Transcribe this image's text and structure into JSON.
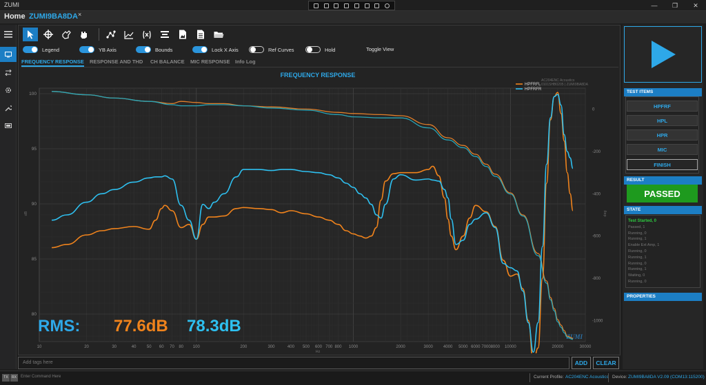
{
  "app": {
    "title": "ZUMI"
  },
  "tabs": {
    "home": "Home",
    "device": "ZUMI9BA8DA",
    "close_glyph": "×"
  },
  "toolbar": {
    "icons": [
      "select-arrow-icon",
      "crosshair-icon",
      "pan-hand-icon",
      "grab-hand-icon",
      "scatter-icon",
      "line-chart-icon",
      "function-icon",
      "align-icon",
      "export-image-icon",
      "document-icon",
      "open-folder-icon"
    ]
  },
  "toggles": {
    "legend": "Legend",
    "yb_axis": "YB Axis",
    "bounds": "Bounds",
    "lock_x_axis": "Lock X Axis",
    "ref_curves": "Ref Curves",
    "hold": "Hold",
    "toggle_view": "Toggle View"
  },
  "subtabs": [
    "FREQUENCY RESPONSE",
    "RESPONSE AND THD",
    "CH BALANCE",
    "MIC RESPONSE",
    "Info Log"
  ],
  "chart_data": {
    "type": "line",
    "title": "FREQUENCY RESPONSE",
    "watermark_lines": [
      "AC204ENC Acoustics",
      "0101SHB0205 | ZUMI9BA8DA"
    ],
    "brand_mark": "ZUMI",
    "xlabel": "Hz",
    "ylabel": "dB",
    "y2label": "deg",
    "x_scale": "log",
    "xlim": [
      10,
      30000
    ],
    "ylim": [
      77.5,
      100.5
    ],
    "y2lim": [
      -1100,
      100
    ],
    "x_ticks": [
      "10",
      "20",
      "30",
      "40",
      "50",
      "60",
      "70",
      "80",
      "100",
      "200",
      "300",
      "400",
      "500",
      "600",
      "700",
      "800",
      "1000",
      "2000",
      "3000",
      "4000",
      "5000",
      "6000",
      "7000",
      "8000",
      "10000",
      "20000",
      "30000"
    ],
    "y_ticks": [
      "100",
      "95",
      "90",
      "85",
      "80"
    ],
    "y2_ticks": [
      "0",
      "-200",
      "-400",
      "-600",
      "-800",
      "-1000"
    ],
    "grid": true,
    "legend_position": "top-right",
    "series": [
      {
        "name": "HPFRFL",
        "color": "#f0831c",
        "axis": "y2",
        "x": [
          12,
          15,
          20,
          25,
          30,
          40,
          50,
          55,
          60,
          63,
          70,
          80,
          90,
          100,
          110,
          120,
          130,
          150,
          180,
          200,
          250,
          300,
          350,
          400,
          500,
          600,
          700,
          800,
          900,
          1000,
          1100,
          1200,
          1300,
          1400,
          1500,
          1600,
          1800,
          2000,
          2500,
          3000,
          3200,
          3500,
          3800,
          4000,
          4200,
          4500,
          5000,
          5500,
          6000,
          7000,
          8000,
          9000,
          10000,
          11000,
          12000,
          13000,
          14000,
          15000,
          16000,
          17000,
          18000,
          19000,
          20000,
          21000,
          22000,
          23000,
          24000,
          25000
        ],
        "values": [
          -655,
          -640,
          -595,
          -575,
          -565,
          -555,
          -568,
          -525,
          -470,
          -455,
          -480,
          -560,
          -545,
          -615,
          -545,
          -510,
          -510,
          -505,
          -470,
          -465,
          -470,
          -475,
          -490,
          -480,
          -495,
          -510,
          -525,
          -545,
          -575,
          -590,
          -600,
          -610,
          -600,
          -560,
          -430,
          -340,
          -305,
          -300,
          -300,
          -285,
          -270,
          -315,
          -420,
          -520,
          -600,
          -665,
          -600,
          -515,
          -455,
          -485,
          -555,
          -715,
          -790,
          -780,
          -850,
          -1000,
          -1200,
          -1130,
          -800,
          -350,
          -50,
          60,
          80,
          -20,
          -150,
          -300,
          -400,
          -480
        ]
      },
      {
        "name": "HPFRFR",
        "color": "#2ec0f0",
        "axis": "y2",
        "x": [
          12,
          15,
          20,
          25,
          30,
          40,
          50,
          55,
          60,
          63,
          70,
          80,
          90,
          100,
          110,
          120,
          130,
          150,
          180,
          200,
          250,
          300,
          350,
          400,
          500,
          600,
          700,
          800,
          900,
          1000,
          1100,
          1200,
          1300,
          1400,
          1500,
          1600,
          1800,
          2000,
          2500,
          3000,
          3200,
          3500,
          3800,
          4000,
          4200,
          4500,
          5000,
          5500,
          6000,
          7000,
          8000,
          9000,
          10000,
          11000,
          12000,
          13000,
          14000,
          15000,
          16000,
          17000,
          18000,
          19000,
          20000,
          21000,
          22000,
          23000,
          24000,
          25000
        ],
        "values": [
          -525,
          -500,
          -440,
          -400,
          -380,
          -345,
          -325,
          -320,
          -320,
          -315,
          -330,
          -455,
          -525,
          -615,
          -450,
          -470,
          -440,
          -400,
          -320,
          -285,
          -285,
          -290,
          -285,
          -285,
          -295,
          -300,
          -310,
          -325,
          -350,
          -370,
          -400,
          -420,
          -450,
          -500,
          -515,
          -450,
          -330,
          -310,
          -335,
          -330,
          -335,
          -340,
          -380,
          -420,
          -520,
          -640,
          -620,
          -545,
          -520,
          -490,
          -560,
          -730,
          -750,
          -765,
          -860,
          -1010,
          -1150,
          -1010,
          -650,
          -260,
          -40,
          60,
          70,
          20,
          -120,
          -200,
          -230,
          -280
        ]
      },
      {
        "name": "",
        "color": "#e07e2a",
        "axis": "y",
        "x": [
          12,
          20,
          30,
          50,
          70,
          80,
          100,
          120,
          150,
          200,
          300,
          500,
          800,
          1000,
          1500,
          2000,
          3000,
          4000,
          5000,
          6000,
          7000,
          8000,
          10000,
          12000,
          15000,
          17000,
          18000,
          19000,
          20000,
          21000,
          22000,
          23000,
          25000
        ],
        "values": [
          100.2,
          99.9,
          99.6,
          99.3,
          99.1,
          99.3,
          99.2,
          99.1,
          99.1,
          98.9,
          98.8,
          98.6,
          98.3,
          98.2,
          98.1,
          98.0,
          97.2,
          96.0,
          95.3,
          94.5,
          93.6,
          92.7,
          91.0,
          89.0,
          85.5,
          83.0,
          81.5,
          80.5,
          79.5,
          79.0,
          78.5,
          78.0,
          77.8
        ]
      },
      {
        "name": "",
        "color": "#27a5b8",
        "axis": "y",
        "x": [
          12,
          20,
          30,
          50,
          70,
          80,
          100,
          120,
          150,
          200,
          300,
          500,
          800,
          1000,
          1500,
          2000,
          3000,
          4000,
          5000,
          6000,
          7000,
          8000,
          10000,
          12000,
          15000,
          17000,
          18000,
          19000,
          20000,
          21000,
          22000,
          23000,
          25000
        ],
        "values": [
          100.2,
          99.9,
          99.6,
          99.3,
          99.0,
          98.9,
          98.9,
          99.0,
          99.0,
          98.9,
          98.7,
          98.5,
          98.1,
          97.9,
          97.8,
          97.8,
          96.9,
          95.8,
          95.1,
          94.3,
          93.4,
          92.5,
          90.9,
          88.9,
          85.3,
          82.8,
          81.3,
          80.3,
          79.3,
          78.8,
          78.3,
          77.9,
          77.7
        ]
      }
    ]
  },
  "rms": {
    "label": "RMS:",
    "value_left": "77.6dB",
    "value_right": "78.3dB"
  },
  "bottom": {
    "tags_placeholder": "Add tags here",
    "add": "ADD",
    "clear": "CLEAR"
  },
  "right_panel": {
    "test_items_header": "TEST ITEMS",
    "items": [
      "HPFRF",
      "HPL",
      "HPR",
      "MIC",
      "FINISH"
    ],
    "result_header": "RESULT",
    "result": "PASSED",
    "result_color": "#1e9a1e",
    "state_header": "STATE",
    "state_lines": [
      "Test Started, 0",
      "Passed, 1",
      "Running, 0",
      "Running, 1",
      "Enable Ext Amp, 1",
      "Running, 0",
      "Running, 1",
      "Running, 0",
      "Running, 1",
      "Waiting, 0",
      "Running, 0"
    ],
    "properties_header": "PROPERTIES"
  },
  "statusbar": {
    "tx": "TX",
    "rx": "RX",
    "command_placeholder": "Enter Command Here",
    "profile_label": "Current Profile:",
    "profile_value": "AC204ENC Acoustics",
    "device_label": "Device:",
    "device_value": "ZUMI9BA8DA V2.09 (COM13:115200)"
  },
  "colors": {
    "accent": "#2ea8e8",
    "panel": "#232323",
    "pass_green": "#1e9a1e"
  }
}
